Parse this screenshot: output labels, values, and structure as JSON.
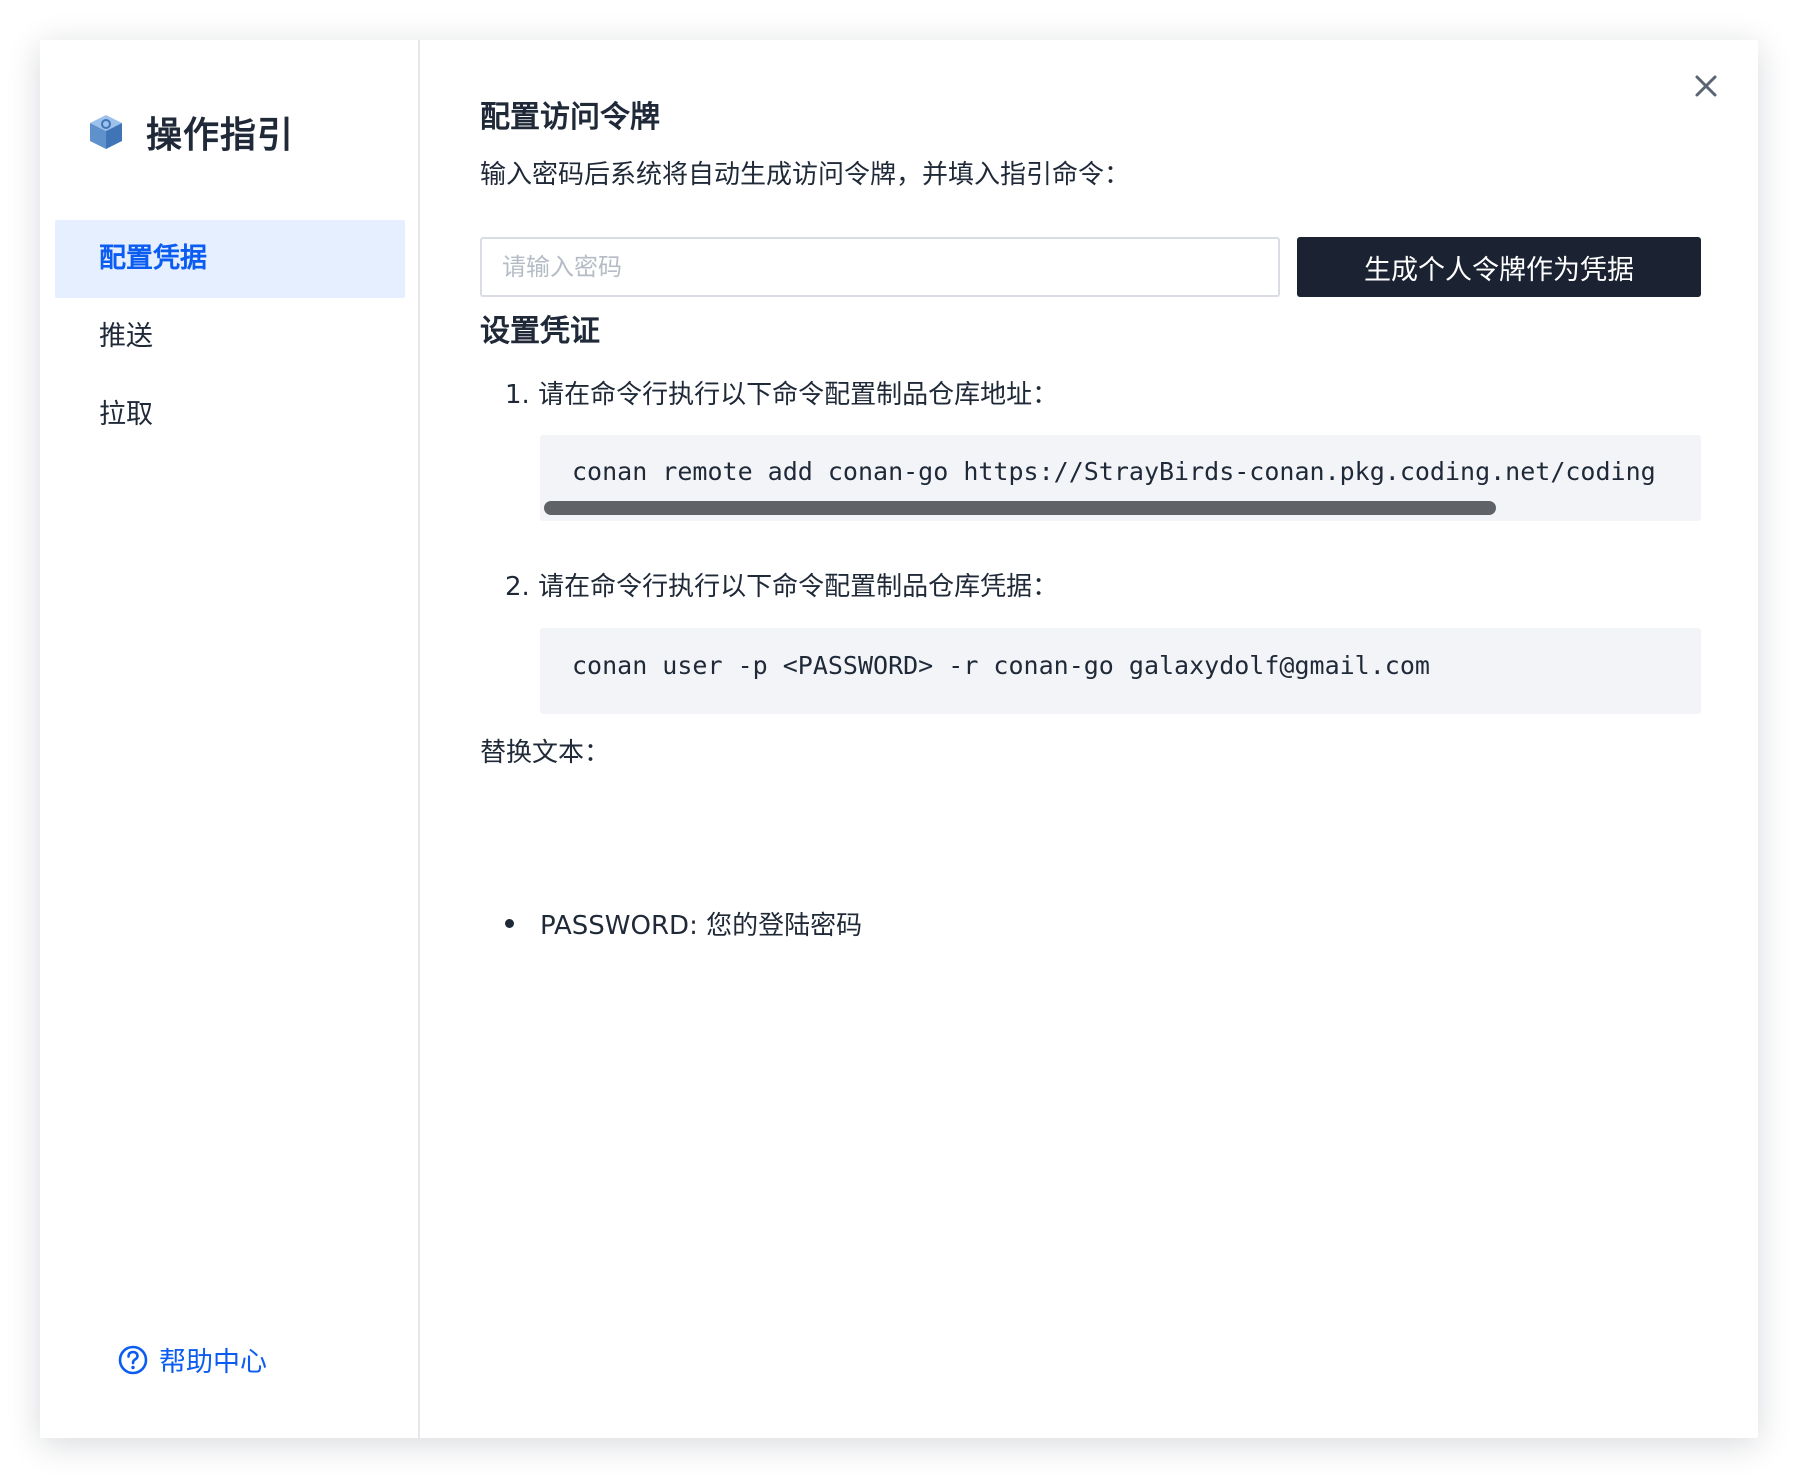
{
  "sidebar": {
    "title": "操作指引",
    "nav": [
      {
        "label": "配置凭据",
        "active": true
      },
      {
        "label": "推送",
        "active": false
      },
      {
        "label": "拉取",
        "active": false
      }
    ],
    "help_label": "帮助中心"
  },
  "main": {
    "token_section": {
      "title": "配置访问令牌",
      "description": "输入密码后系统将自动生成访问令牌，并填入指引命令：",
      "password_placeholder": "请输入密码",
      "generate_button": "生成个人令牌作为凭据"
    },
    "credential_section": {
      "title": "设置凭证",
      "steps": [
        {
          "label": "1. 请在命令行执行以下命令配置制品仓库地址：",
          "command": "conan remote add conan-go https://StrayBirds-conan.pkg.coding.net/coding"
        },
        {
          "label": "2. 请在命令行执行以下命令配置制品仓库凭据：",
          "command": "conan user -p <PASSWORD> -r conan-go galaxydolf@gmail.com"
        }
      ],
      "replace_title": "替换文本：",
      "replacements": [
        "PASSWORD: 您的登陆密码"
      ]
    }
  },
  "colors": {
    "accent": "#0b5cf0",
    "active_bg": "#e6efff",
    "button_bg": "#1b2232",
    "code_bg": "#f2f4f8"
  }
}
